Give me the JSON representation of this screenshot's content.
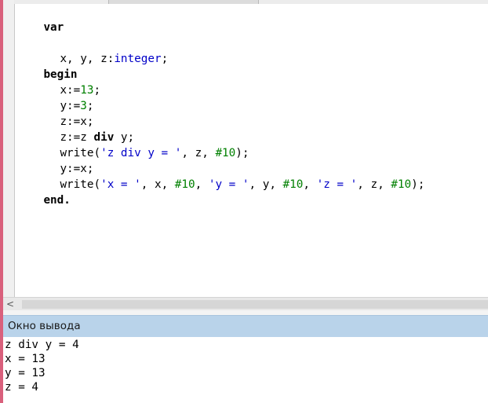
{
  "editor": {
    "line_var": "var",
    "line_decl_vars": "x, y, z:",
    "line_decl_type": "integer",
    "line_decl_end": ";",
    "line_begin": "begin",
    "line_x_assign": "x:=",
    "line_x_value": "13",
    "line_x_end": ";",
    "line_y_assign": "y:=",
    "line_y_value": "3",
    "line_y_end": ";",
    "line_z_assign": "z:=x;",
    "line_zdiv_left": "z:=z ",
    "line_zdiv_kw": "div",
    "line_zdiv_right": " y;",
    "line_w1_open": "write(",
    "line_w1_str": "'z div y = '",
    "line_w1_mid": ", z, ",
    "line_w1_char": "#10",
    "line_w1_end": ");",
    "line_yx": "y:=x;",
    "line_w2_open": "write(",
    "line_w2_s1": "'x = '",
    "line_w2_m1": ", x, ",
    "line_w2_c1": "#10",
    "line_w2_m2": ", ",
    "line_w2_s2": "'y = '",
    "line_w2_m3": ", y, ",
    "line_w2_c2": "#10",
    "line_w2_m4": ", ",
    "line_w2_s3": "'z = '",
    "line_w2_m5": ", z, ",
    "line_w2_c3": "#10",
    "line_w2_end": ");",
    "line_end": "end."
  },
  "scrollbar": {
    "left_arrow": "<"
  },
  "output_panel": {
    "title": "Окно вывода",
    "lines": [
      "z div y = 4",
      "x = 13",
      "y = 13",
      "z = 4"
    ]
  },
  "colors": {
    "keyword": "#000000",
    "type": "#0000c8",
    "number": "#008000",
    "string": "#0000c8",
    "panel_header": "#b9d3ea",
    "left_accent": "#d9607c"
  }
}
